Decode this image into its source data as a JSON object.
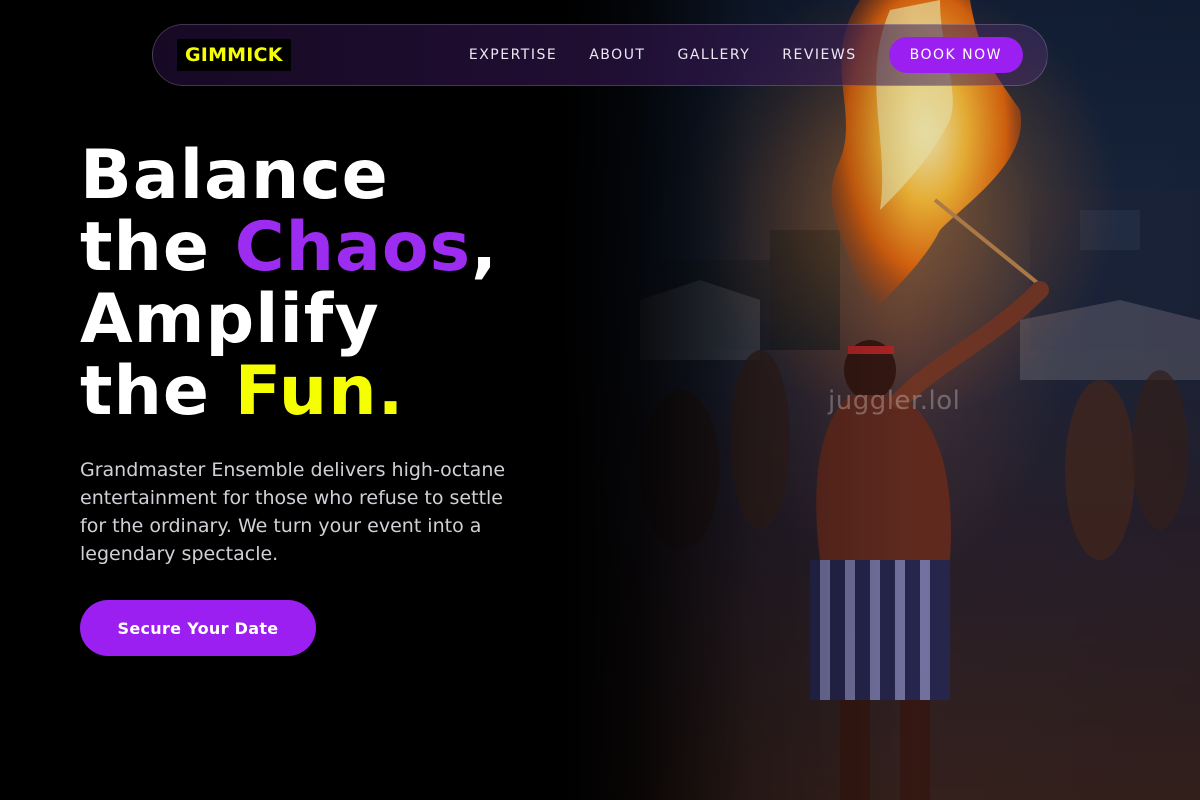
{
  "nav": {
    "logo": "GIMMICK",
    "links": [
      "EXPERTISE",
      "ABOUT",
      "GALLERY",
      "REVIEWS"
    ],
    "cta_label": "BOOK NOW"
  },
  "hero": {
    "line1": "Balance",
    "line2_pre": "the ",
    "line2_accent": "Chaos",
    "line2_post": ",",
    "line3": "Amplify",
    "line4_pre": "the ",
    "line4_accent": "Fun.",
    "description": "Grandmaster Ensemble delivers high-octane entertainment for those who refuse to settle for the ordinary. We turn your event into a legendary spectacle.",
    "cta_label": "Secure Your Date",
    "watermark": "juggler.lol"
  },
  "colors": {
    "accent_purple": "#9b1ff0",
    "accent_yellow": "#f6ff00",
    "background": "#000000"
  }
}
